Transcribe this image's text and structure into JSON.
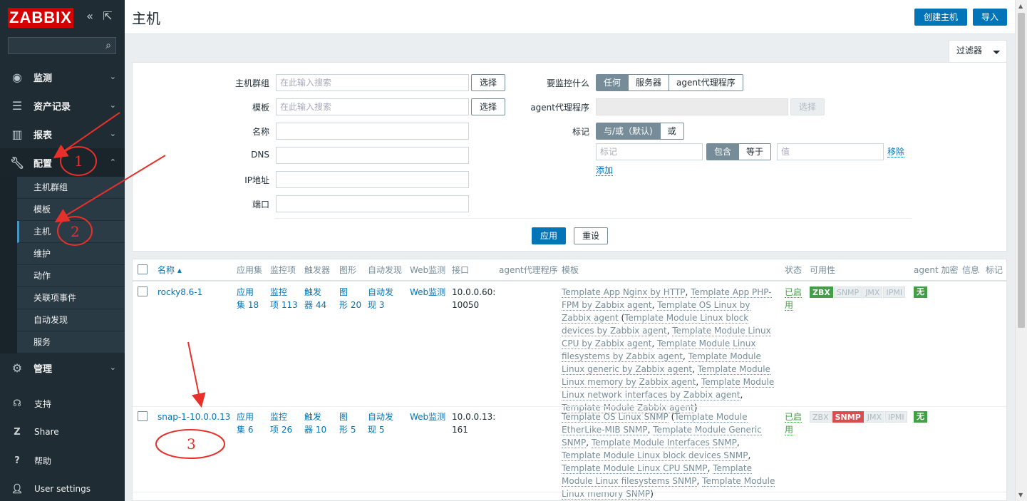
{
  "sidebar": {
    "logo": "ZABBIX",
    "collapse_icon": "«",
    "kiosk_icon": "⇱",
    "search_value": "",
    "nav": [
      {
        "label": "监测",
        "icon": "eye-icon"
      },
      {
        "label": "资产记录",
        "icon": "list-icon"
      },
      {
        "label": "报表",
        "icon": "chart-icon"
      },
      {
        "label": "配置",
        "icon": "wrench-icon"
      }
    ],
    "config_sub": [
      "主机群组",
      "模板",
      "主机",
      "维护",
      "动作",
      "关联项事件",
      "自动发现",
      "服务"
    ],
    "admin": {
      "label": "管理",
      "icon": "gear-icon"
    },
    "bottom": [
      {
        "label": "支持",
        "icon": "headset-icon"
      },
      {
        "label": "Share",
        "icon": "share-icon"
      },
      {
        "label": "帮助",
        "icon": "help-icon"
      },
      {
        "label": "User settings",
        "icon": "user-icon"
      }
    ]
  },
  "header": {
    "title": "主机",
    "create_host": "创建主机",
    "import": "导入"
  },
  "filter": {
    "tab_label": "过滤器",
    "host_groups_label": "主机群组",
    "templates_label": "模板",
    "name_label": "名称",
    "dns_label": "DNS",
    "ip_label": "IP地址",
    "port_label": "端口",
    "placeholder": "在此输入搜索",
    "select": "选择",
    "monitored_by_label": "要监控什么",
    "monitored_by": [
      "任何",
      "服务器",
      "agent代理程序"
    ],
    "proxy_label": "agent代理程序",
    "tags_label": "标记",
    "tags_mode": [
      "与/或（默认)",
      "或"
    ],
    "tag_placeholder": "标记",
    "tag_ops": [
      "包含",
      "等于"
    ],
    "value_placeholder": "值",
    "remove": "移除",
    "add": "添加",
    "apply": "应用",
    "reset": "重设"
  },
  "table": {
    "headers": {
      "name": "名称 ▴",
      "apps": "应用集",
      "items": "监控项",
      "triggers": "触发器",
      "graphs": "图形",
      "discovery": "自动发现",
      "web": "Web监测",
      "interface": "接口",
      "proxy": "agent代理程序",
      "templates": "模板",
      "status": "状态",
      "availability": "可用性",
      "encryption": "agent 加密",
      "info": "信息",
      "tags": "标记"
    },
    "rows": [
      {
        "name": "rocky8.6-1",
        "apps": [
          "应用",
          "集 18"
        ],
        "items": [
          "监控",
          "项 113"
        ],
        "triggers": [
          "触发",
          "器 44"
        ],
        "graphs": [
          "图",
          "形 20"
        ],
        "discovery": [
          "自动发",
          "现 3"
        ],
        "web": "Web监测",
        "interface": [
          "10.0.0.60:",
          "10050"
        ],
        "status": "已启用",
        "enc": "无"
      },
      {
        "name": "snap-1-10.0.0.13",
        "apps": [
          "应用",
          "集 6"
        ],
        "items": [
          "监控",
          "项 26"
        ],
        "triggers": [
          "触发",
          "器 10"
        ],
        "graphs": [
          "图",
          "形 5"
        ],
        "discovery": [
          "自动发",
          "现 5"
        ],
        "web": "Web监测",
        "interface": [
          "10.0.0.13:",
          "161"
        ],
        "status": "已启用",
        "enc": "无"
      }
    ],
    "row1_templates": [
      "Template App Nginx by HTTP",
      ", ",
      "Template App PHP-FPM by Zabbix agent",
      ", ",
      "Template OS Linux by Zabbix agent",
      " (",
      "Template Module Linux block devices by Zabbix agent",
      ", ",
      "Template Module Linux CPU by Zabbix agent",
      ", ",
      "Template Module Linux filesystems by Zabbix agent",
      ", ",
      "Template Module Linux generic by Zabbix agent",
      ", ",
      "Template Module Linux memory by Zabbix agent",
      ", ",
      "Template Module Linux network interfaces by Zabbix agent",
      ", ",
      "Template Module Zabbix agent",
      ")"
    ],
    "row2_templates": [
      "Template OS Linux SNMP",
      " (",
      "Template Module EtherLike-MIB SNMP",
      ", ",
      "Template Module Generic SNMP",
      ", ",
      "Template Module Interfaces SNMP",
      ", ",
      "Template Module Linux block devices SNMP",
      ", ",
      "Template Module Linux CPU SNMP",
      ", ",
      "Template Module Linux filesystems SNMP",
      ", ",
      "Template Module Linux memory SNMP",
      ")"
    ],
    "availability_labels": [
      "ZBX",
      "SNMP",
      "JMX",
      "IPMI"
    ]
  },
  "annotations": {
    "one": "1",
    "two": "2",
    "three": "3"
  },
  "colors": {
    "accent": "#0275b8",
    "sidebar": "#1f2c33",
    "logo": "#d40000",
    "enabled": "#429e47",
    "error": "#d64e4e",
    "annotation": "#e8302a"
  }
}
